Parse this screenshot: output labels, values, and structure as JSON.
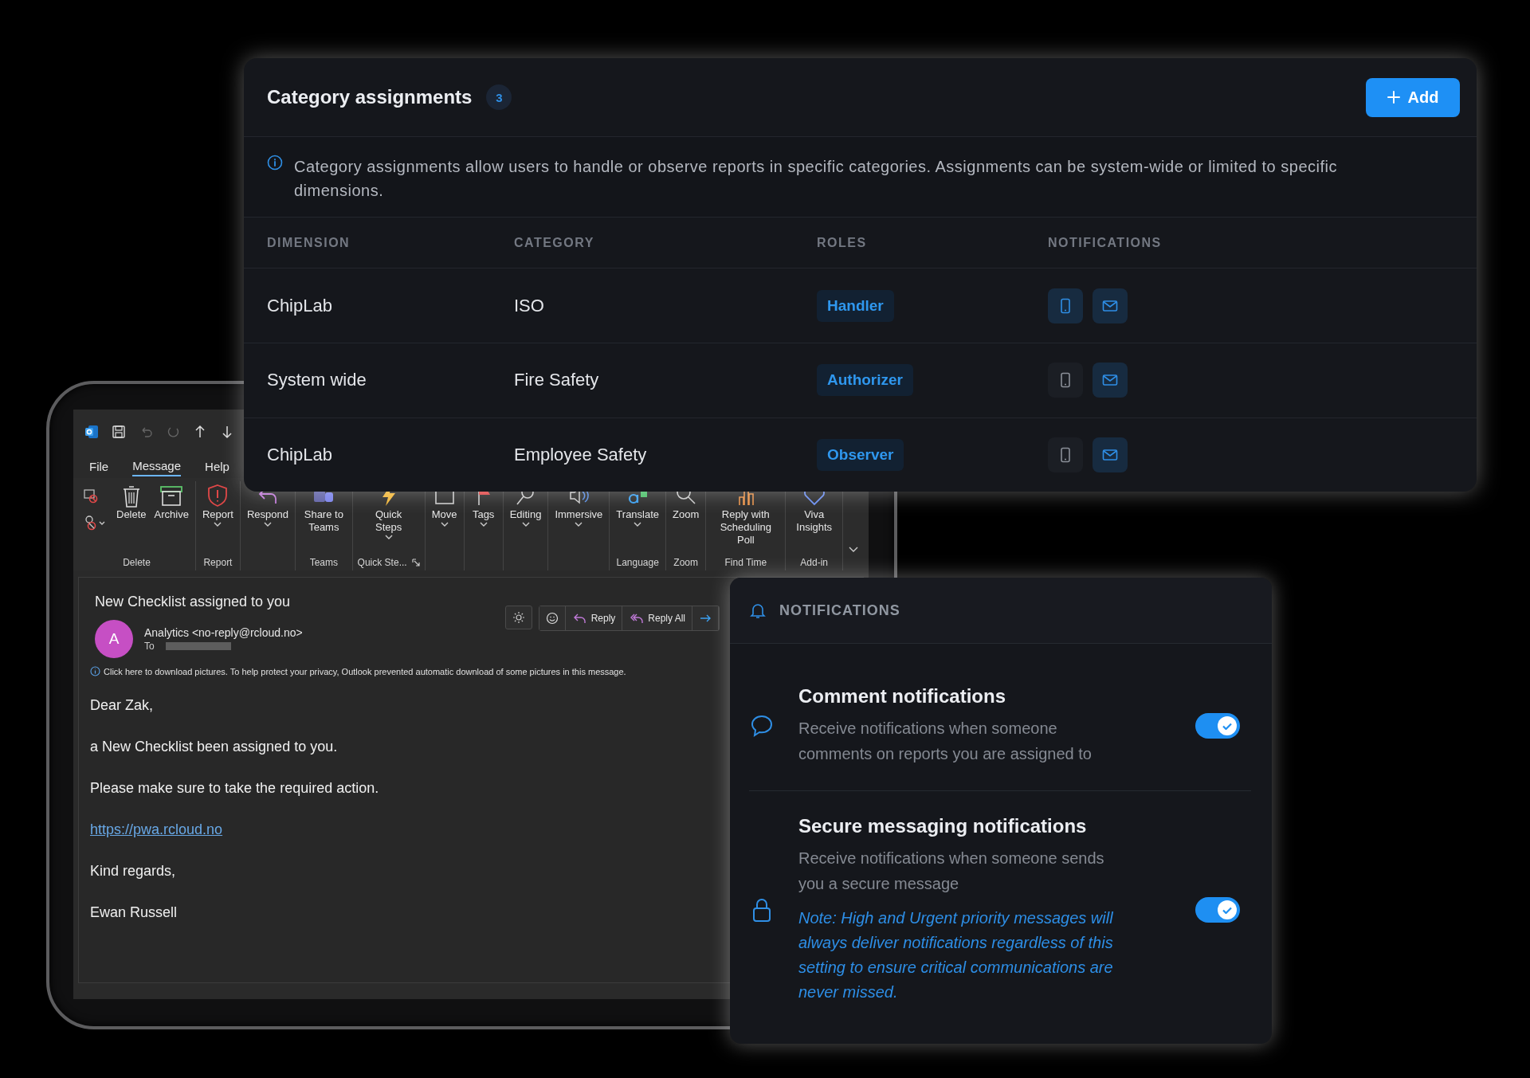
{
  "category_panel": {
    "title": "Category assignments",
    "count": "3",
    "add_button": "Add",
    "info": "Category assignments allow users to handle or observe reports in specific categories. Assignments can be system-wide or limited to specific dimensions.",
    "columns": [
      "DIMENSION",
      "CATEGORY",
      "ROLES",
      "NOTIFICATIONS"
    ],
    "rows": [
      {
        "dimension": "ChipLab",
        "category": "ISO",
        "role": "Handler",
        "sms_on": true,
        "email_on": true
      },
      {
        "dimension": "System wide",
        "category": "Fire Safety",
        "role": "Authorizer",
        "sms_on": false,
        "email_on": true
      },
      {
        "dimension": "ChipLab",
        "category": "Employee Safety",
        "role": "Observer",
        "sms_on": false,
        "email_on": true
      }
    ]
  },
  "email_client": {
    "menu_tabs": [
      {
        "label": "File",
        "selected": false
      },
      {
        "label": "Message",
        "selected": true
      },
      {
        "label": "Help",
        "selected": false
      }
    ],
    "ribbon": [
      {
        "label": "Delete",
        "buttons": [
          {
            "label": "Delete",
            "dropdown": false
          },
          {
            "label": "Archive",
            "dropdown": false
          }
        ]
      },
      {
        "label": "Report",
        "buttons": [
          {
            "label": "Report",
            "dropdown": true
          }
        ]
      },
      {
        "buttons": [
          {
            "label": "Respond",
            "dropdown": true
          }
        ]
      },
      {
        "label": "Teams",
        "buttons": [
          {
            "label": "Share to Teams",
            "dropdown": false
          }
        ]
      },
      {
        "label": "Quick Ste...",
        "launcher": true,
        "buttons": [
          {
            "label": "Quick Steps",
            "dropdown": true
          }
        ]
      },
      {
        "buttons": [
          {
            "label": "Move",
            "dropdown": true
          }
        ]
      },
      {
        "buttons": [
          {
            "label": "Tags",
            "dropdown": true
          }
        ]
      },
      {
        "buttons": [
          {
            "label": "Editing",
            "dropdown": true
          }
        ]
      },
      {
        "buttons": [
          {
            "label": "Immersive",
            "dropdown": true
          }
        ]
      },
      {
        "label": "Language",
        "buttons": [
          {
            "label": "Translate",
            "dropdown": true
          }
        ]
      },
      {
        "label": "Zoom",
        "buttons": [
          {
            "label": "Zoom",
            "dropdown": false
          }
        ]
      },
      {
        "label": "Find Time",
        "buttons": [
          {
            "label": "Reply with Scheduling Poll",
            "dropdown": false
          }
        ]
      },
      {
        "label": "Add-in",
        "buttons": [
          {
            "label": "Viva Insights",
            "dropdown": false
          }
        ]
      }
    ],
    "message": {
      "subject": "New Checklist assigned to you",
      "avatar": "A",
      "sender": "Analytics <no-reply@rcloud.no>",
      "to_label": "To",
      "actions": [
        "Reply",
        "Reply All"
      ],
      "banner": "Click here to download pictures. To help protect your privacy, Outlook prevented automatic download of some pictures in this message.",
      "body": [
        {
          "kind": "text",
          "text": "Dear Zak,"
        },
        {
          "kind": "text",
          "text": "a New Checklist been assigned to you."
        },
        {
          "kind": "text",
          "text": "Please make sure to take the required action."
        },
        {
          "kind": "link",
          "text": "https://pwa.rcloud.no"
        },
        {
          "kind": "text",
          "text": "Kind regards,"
        },
        {
          "kind": "text",
          "text": "Ewan Russell"
        }
      ]
    }
  },
  "notifications_panel": {
    "title": "NOTIFICATIONS",
    "items": [
      {
        "title": "Comment notifications",
        "description": "Receive notifications when someone comments on reports you are assigned to",
        "on": true
      },
      {
        "title": "Secure messaging notifications",
        "description": "Receive notifications when someone sends you a secure message",
        "note": "Note: High and Urgent priority messages will always deliver notifications regardless of this setting to ensure critical communications are never missed.",
        "on": true
      }
    ]
  }
}
